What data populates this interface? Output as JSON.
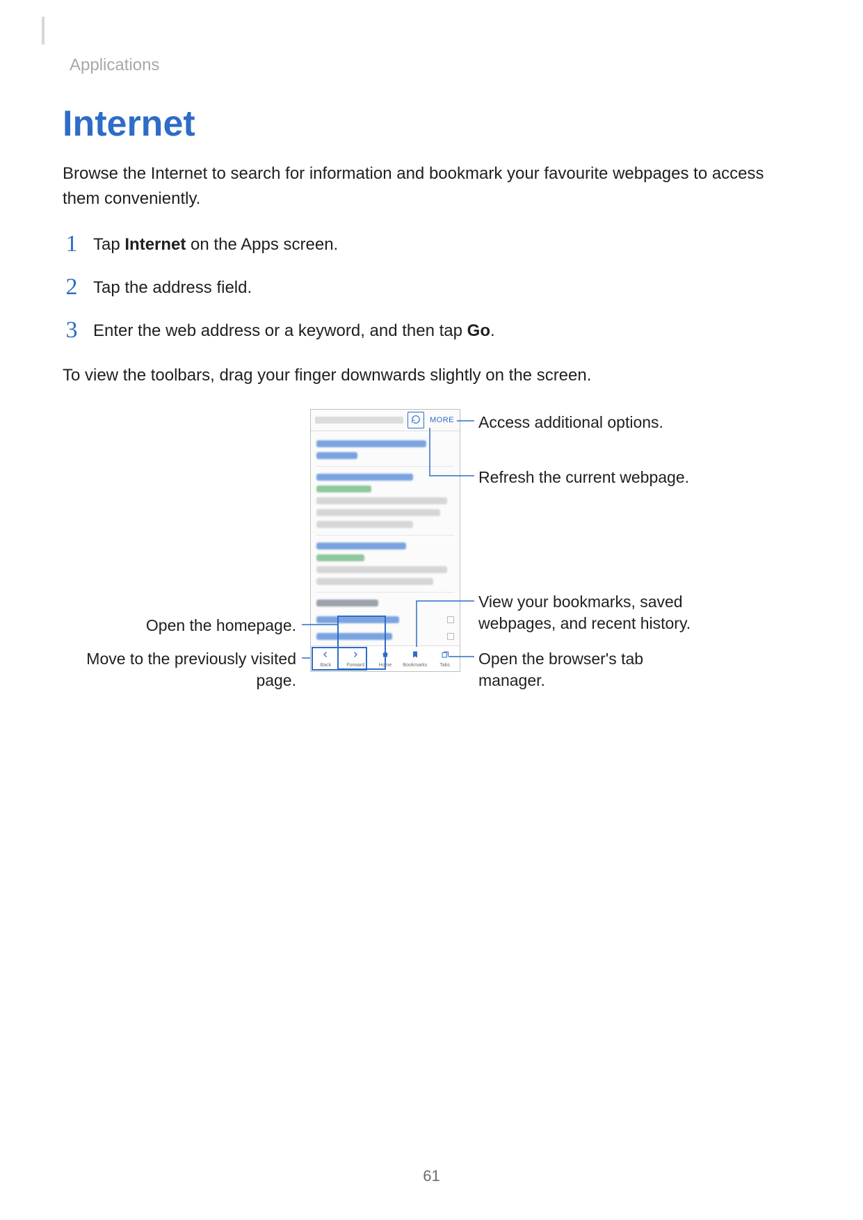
{
  "breadcrumb": "Applications",
  "title": "Internet",
  "intro": "Browse the Internet to search for information and bookmark your favourite webpages to access them conveniently.",
  "steps": [
    {
      "num": "1",
      "pre": "Tap ",
      "bold": "Internet",
      "post": " on the Apps screen."
    },
    {
      "num": "2",
      "pre": "Tap the address field.",
      "bold": "",
      "post": ""
    },
    {
      "num": "3",
      "pre": "Enter the web address or a keyword, and then tap ",
      "bold": "Go",
      "post": "."
    }
  ],
  "note": "To view the toolbars, drag your finger downwards slightly on the screen.",
  "phone": {
    "more_label": "MORE",
    "toolbar": {
      "back": "Back",
      "forward": "Forward",
      "home": "Home",
      "bookmarks": "Bookmarks",
      "tabs": "Tabs"
    }
  },
  "callouts": {
    "more": "Access additional options.",
    "refresh": "Refresh the current webpage.",
    "bookmarks": "View your bookmarks, saved webpages, and recent history.",
    "tabs": "Open the browser's tab manager.",
    "home": "Open the homepage.",
    "back": "Move to the previously visited page."
  },
  "page_number": "61"
}
